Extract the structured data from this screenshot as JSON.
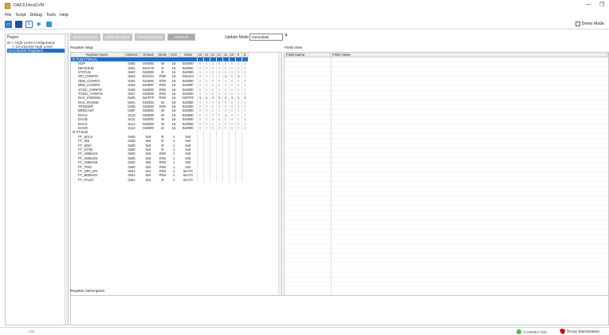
{
  "window": {
    "title": "DAC614xxEVM",
    "minimize": "—",
    "restore": "❐"
  },
  "menu": [
    "File",
    "Script",
    "Debug",
    "Tools",
    "Help"
  ],
  "toolbar": {
    "demo_mode_label": "Demo Mode"
  },
  "pages": {
    "header": "Pages",
    "items": [
      "⊟ ◇ High Level Configuration",
      "     ◇ DAC61404 High Level",
      "DAC61404 Registers"
    ]
  },
  "buttons": {
    "write_selected": "Write Selected",
    "write_modified": "Write Modified",
    "read_selected": "Read Selected",
    "read_all": "Read All"
  },
  "update_mode": {
    "label": "Update Mode",
    "value": "Immediate"
  },
  "register_map": {
    "label": "Register Map",
    "columns": [
      "Register Name",
      "Address",
      "Default",
      "Mode",
      "Size",
      "Value",
      "15",
      "14",
      "13",
      "12",
      "11",
      "10",
      "9",
      "8"
    ],
    "rows": [
      {
        "name": "⊟ FUNCTIONAL",
        "address": "",
        "default": "",
        "mode": "",
        "size": "",
        "value": "",
        "bits": [
          "",
          "",
          "",
          "",
          "",
          "",
          "",
          ""
        ],
        "group": true,
        "selected": true
      },
      {
        "name": "NOP",
        "address": "0x00",
        "default": "0x0000",
        "mode": "W",
        "size": "16",
        "value": "0x0000",
        "bits": [
          "0",
          "0",
          "0",
          "0",
          "0",
          "0",
          "0",
          "0"
        ]
      },
      {
        "name": "DEVICEID",
        "address": "0x01",
        "default": "0x0A70",
        "mode": "R",
        "size": "16",
        "value": "0x0000",
        "bits": [
          "0",
          "0",
          "0",
          "0",
          "0",
          "0",
          "0",
          "0"
        ]
      },
      {
        "name": "STATUS",
        "address": "0x02",
        "default": "0x0000",
        "mode": "R",
        "size": "16",
        "value": "0x0000",
        "bits": [
          "0",
          "0",
          "0",
          "0",
          "0",
          "0",
          "0",
          "0"
        ]
      },
      {
        "name": "SPI_CONFIG",
        "address": "0x03",
        "default": "0x0A24",
        "mode": "R/W",
        "size": "16",
        "value": "0x0A24",
        "bits": [
          "0",
          "0",
          "0",
          "0",
          "1",
          "0",
          "1",
          "0"
        ]
      },
      {
        "name": "GEN_CONFIG",
        "address": "0x04",
        "default": "0x4000",
        "mode": "R/W",
        "size": "16",
        "value": "0x0000",
        "bits": [
          "0",
          "0",
          "0",
          "0",
          "0",
          "0",
          "0",
          "0"
        ]
      },
      {
        "name": "BRD_CONFIG",
        "address": "0x05",
        "default": "0x000F",
        "mode": "R/W",
        "size": "16",
        "value": "0x000F",
        "bits": [
          "0",
          "0",
          "0",
          "0",
          "0",
          "0",
          "0",
          "0"
        ]
      },
      {
        "name": "SYNC_CONFIG",
        "address": "0x06",
        "default": "0x0000",
        "mode": "R/W",
        "size": "16",
        "value": "0x0000",
        "bits": [
          "0",
          "0",
          "0",
          "0",
          "0",
          "0",
          "0",
          "0"
        ]
      },
      {
        "name": "TOGG_CONFIG",
        "address": "0x07",
        "default": "0x0000",
        "mode": "R/W",
        "size": "16",
        "value": "0x0000",
        "bits": [
          "0",
          "0",
          "0",
          "0",
          "0",
          "0",
          "0",
          "0"
        ]
      },
      {
        "name": "DAC_PWDWN",
        "address": "0x09",
        "default": "0xFFFF",
        "mode": "R/W",
        "size": "16",
        "value": "0xFFFF",
        "bits": [
          "1",
          "1",
          "1",
          "1",
          "1",
          "1",
          "1",
          "1"
        ]
      },
      {
        "name": "DAC_RANGE",
        "address": "0x0A",
        "default": "0x0000",
        "mode": "W",
        "size": "16",
        "value": "0x0000",
        "bits": [
          "0",
          "0",
          "0",
          "0",
          "0",
          "0",
          "0",
          "0"
        ]
      },
      {
        "name": "TRIGGER",
        "address": "0x0E",
        "default": "0x0000",
        "mode": "R/W",
        "size": "16",
        "value": "0x0000",
        "bits": [
          "0",
          "0",
          "0",
          "0",
          "0",
          "0",
          "0",
          "0"
        ]
      },
      {
        "name": "BRDCAST",
        "address": "0x0F",
        "default": "0x0000",
        "mode": "W",
        "size": "16",
        "value": "0x0000",
        "bits": [
          "0",
          "0",
          "0",
          "0",
          "0",
          "0",
          "0",
          "0"
        ]
      },
      {
        "name": "DACA",
        "address": "0x10",
        "default": "0x0000",
        "mode": "W",
        "size": "16",
        "value": "0x0800",
        "bits": [
          "0",
          "0",
          "0",
          "0",
          "1",
          "0",
          "0",
          "0"
        ]
      },
      {
        "name": "DACB",
        "address": "0x11",
        "default": "0x0000",
        "mode": "W",
        "size": "16",
        "value": "0x0000",
        "bits": [
          "0",
          "0",
          "0",
          "0",
          "0",
          "0",
          "0",
          "0"
        ]
      },
      {
        "name": "DACC",
        "address": "0x12",
        "default": "0x0000",
        "mode": "W",
        "size": "16",
        "value": "0x0000",
        "bits": [
          "0",
          "0",
          "0",
          "0",
          "0",
          "0",
          "0",
          "0"
        ]
      },
      {
        "name": "DACD",
        "address": "0x13",
        "default": "0x0000",
        "mode": "W",
        "size": "16",
        "value": "0x0000",
        "bits": [
          "0",
          "0",
          "0",
          "0",
          "0",
          "0",
          "0",
          "0"
        ]
      },
      {
        "name": "⊟ FT4232",
        "address": "",
        "default": "",
        "mode": "",
        "size": "",
        "value": "",
        "bits": [
          "",
          "",
          "",
          "",
          "",
          "",
          "",
          ""
        ],
        "group": true
      },
      {
        "name": "FT_SCLK",
        "address": "0x00",
        "default": "0x0",
        "mode": "R",
        "size": "1",
        "value": "0x0",
        "bits": [
          "",
          "",
          "",
          "",
          "",
          "",
          "",
          ""
        ]
      },
      {
        "name": "FT_SDI",
        "address": "0x00",
        "default": "0x0",
        "mode": "R",
        "size": "1",
        "value": "0x0",
        "bits": [
          "",
          "",
          "",
          "",
          "",
          "",
          "",
          ""
        ]
      },
      {
        "name": "FT_SDO",
        "address": "0x00",
        "default": "0x0",
        "mode": "R",
        "size": "1",
        "value": "0x0",
        "bits": [
          "",
          "",
          "",
          "",
          "",
          "",
          "",
          ""
        ]
      },
      {
        "name": "FT_SYNC",
        "address": "0x00",
        "default": "0x0",
        "mode": "R",
        "size": "1",
        "value": "0x0",
        "bits": [
          "",
          "",
          "",
          "",
          "",
          "",
          "",
          ""
        ]
      },
      {
        "name": "FT_ADBUS4",
        "address": "0x00",
        "default": "0x0",
        "mode": "R/W",
        "size": "1",
        "value": "0x0",
        "bits": [
          "",
          "",
          "",
          "",
          "",
          "",
          "",
          ""
        ]
      },
      {
        "name": "FT_ADBUS5",
        "address": "0x00",
        "default": "0x0",
        "mode": "R/W",
        "size": "1",
        "value": "0x0",
        "bits": [
          "",
          "",
          "",
          "",
          "",
          "",
          "",
          ""
        ]
      },
      {
        "name": "FT_ADBUS6",
        "address": "0x00",
        "default": "0x0",
        "mode": "R/W",
        "size": "1",
        "value": "0x0",
        "bits": [
          "",
          "",
          "",
          "",
          "",
          "",
          "",
          ""
        ]
      },
      {
        "name": "FT_TRIG",
        "address": "0x00",
        "default": "0x0",
        "mode": "R/W",
        "size": "1",
        "value": "0x0",
        "bits": [
          "",
          "",
          "",
          "",
          "",
          "",
          "",
          ""
        ]
      },
      {
        "name": "FT_OPA_EN",
        "address": "0x01",
        "default": "0x1",
        "mode": "R/W",
        "size": "1",
        "value": "0xA70",
        "bits": [
          "",
          "",
          "",
          "",
          "",
          "",
          "",
          ""
        ]
      },
      {
        "name": "FT_BDBUS1",
        "address": "0x01",
        "default": "0x0",
        "mode": "R/W",
        "size": "1",
        "value": "0xA70",
        "bits": [
          "",
          "",
          "",
          "",
          "",
          "",
          "",
          ""
        ]
      },
      {
        "name": "FT_FAULT",
        "address": "0x01",
        "default": "0x1",
        "mode": "R",
        "size": "1",
        "value": "0xA70",
        "bits": [
          "",
          "",
          "",
          "",
          "",
          "",
          "",
          ""
        ]
      }
    ]
  },
  "field_view": {
    "label": "Field View",
    "columns": [
      "Field Name",
      "Field Value"
    ]
  },
  "register_description": {
    "label": "Register Description"
  },
  "status": {
    "left": "Idle",
    "connection": "CONNECTED",
    "brand": "Texas Instruments",
    "led_color": "#38c43a"
  }
}
